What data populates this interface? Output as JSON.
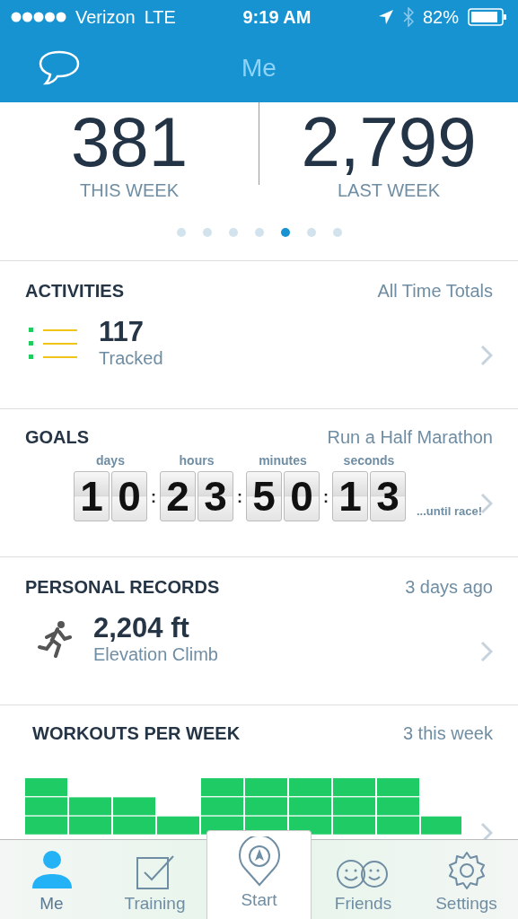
{
  "status_bar": {
    "carrier": "Verizon",
    "network": "LTE",
    "time": "9:19 AM",
    "battery": "82%"
  },
  "nav": {
    "title": "Me"
  },
  "stats": [
    {
      "value": "381",
      "label": "THIS WEEK"
    },
    {
      "value": "2,799",
      "label": "LAST WEEK"
    }
  ],
  "pager": [
    {
      "selected": false
    },
    {
      "selected": false
    },
    {
      "selected": false
    },
    {
      "selected": false
    },
    {
      "selected": true
    },
    {
      "selected": false
    },
    {
      "selected": false
    }
  ],
  "activities": {
    "title": "ACTIVITIES",
    "meta": "All Time Totals",
    "value": "117",
    "caption": "Tracked"
  },
  "goals": {
    "title": "GOALS",
    "meta": "Run a Half Marathon",
    "separator": ":",
    "units": [
      {
        "label": "days",
        "digits": [
          "1",
          "0"
        ]
      },
      {
        "label": "hours",
        "digits": [
          "2",
          "3"
        ]
      },
      {
        "label": "minutes",
        "digits": [
          "5",
          "0"
        ]
      },
      {
        "label": "seconds",
        "digits": [
          "1",
          "3"
        ]
      }
    ],
    "suffix": "...until race!"
  },
  "records": {
    "title": "PERSONAL RECORDS",
    "meta": "3 days ago",
    "value": "2,204 ft",
    "caption": "Elevation Climb"
  },
  "workouts": {
    "title": "WORKOUTS PER WEEK",
    "meta": "3 this week"
  },
  "tab_bar": [
    {
      "label": "Me",
      "selected": true
    },
    {
      "label": "Training",
      "selected": false
    },
    {
      "label": "Start",
      "selected": false
    },
    {
      "label": "Friends",
      "selected": false
    },
    {
      "label": "Settings",
      "selected": false
    }
  ]
}
